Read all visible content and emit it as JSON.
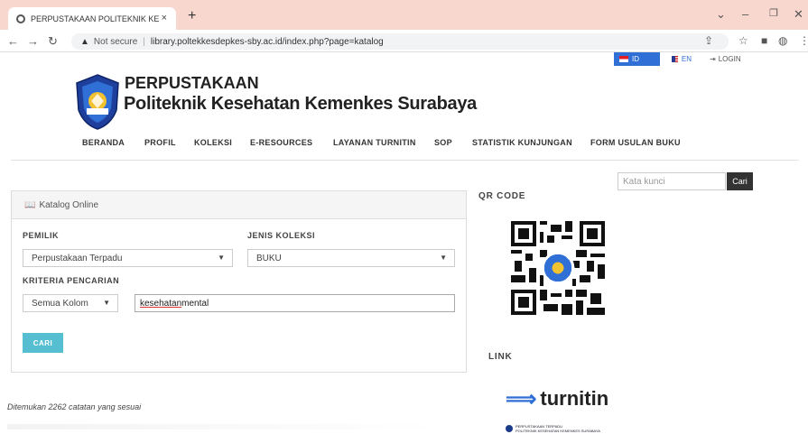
{
  "browser": {
    "tab_title": "PERPUSTAKAAN POLITEKNIK KE",
    "tab_close": "×",
    "new_tab": "+",
    "secure_label": "Not secure",
    "url": "library.poltekkesdepkes-sby.ac.id/index.php?page=katalog"
  },
  "lang": {
    "id": "ID",
    "en": "EN",
    "login": "LOGIN"
  },
  "header": {
    "line1": "PERPUSTAKAAN",
    "line2": "Politeknik Kesehatan Kemenkes Surabaya"
  },
  "nav": [
    "BERANDA",
    "PROFIL",
    "KOLEKSI",
    "E-RESOURCES",
    "LAYANAN TURNITIN",
    "SOP",
    "STATISTIK KUNJUNGAN",
    "FORM USULAN BUKU"
  ],
  "catalog": {
    "title": "Katalog Online",
    "pemilik_label": "PEMILIK",
    "pemilik_value": "Perpustakaan Terpadu",
    "jenis_label": "JENIS KOLEKSI",
    "jenis_value": "BUKU",
    "kriteria_label": "KRITERIA PENCARIAN",
    "kriteria_value": "Semua Kolom",
    "query_word1": "kesehatan",
    "query_word2": " mental",
    "search_button": "CARI"
  },
  "result_text": "Ditemukan 2262 catatan yang sesuai",
  "sidebar": {
    "search_placeholder": "Kata kunci",
    "search_button": "Cari",
    "qr_heading": "QR CODE",
    "link_heading": "LINK",
    "turnitin": "turnitin",
    "poltek_line1": "PERPUSTAKAAN TERPADU",
    "poltek_line2": "POLITEKNIK KESEHATAN KEMENKES SURABAYA"
  },
  "colors": {
    "tab_bar": "#f8d7cf",
    "accent": "#2f6fd6",
    "button": "#55bfd1"
  }
}
